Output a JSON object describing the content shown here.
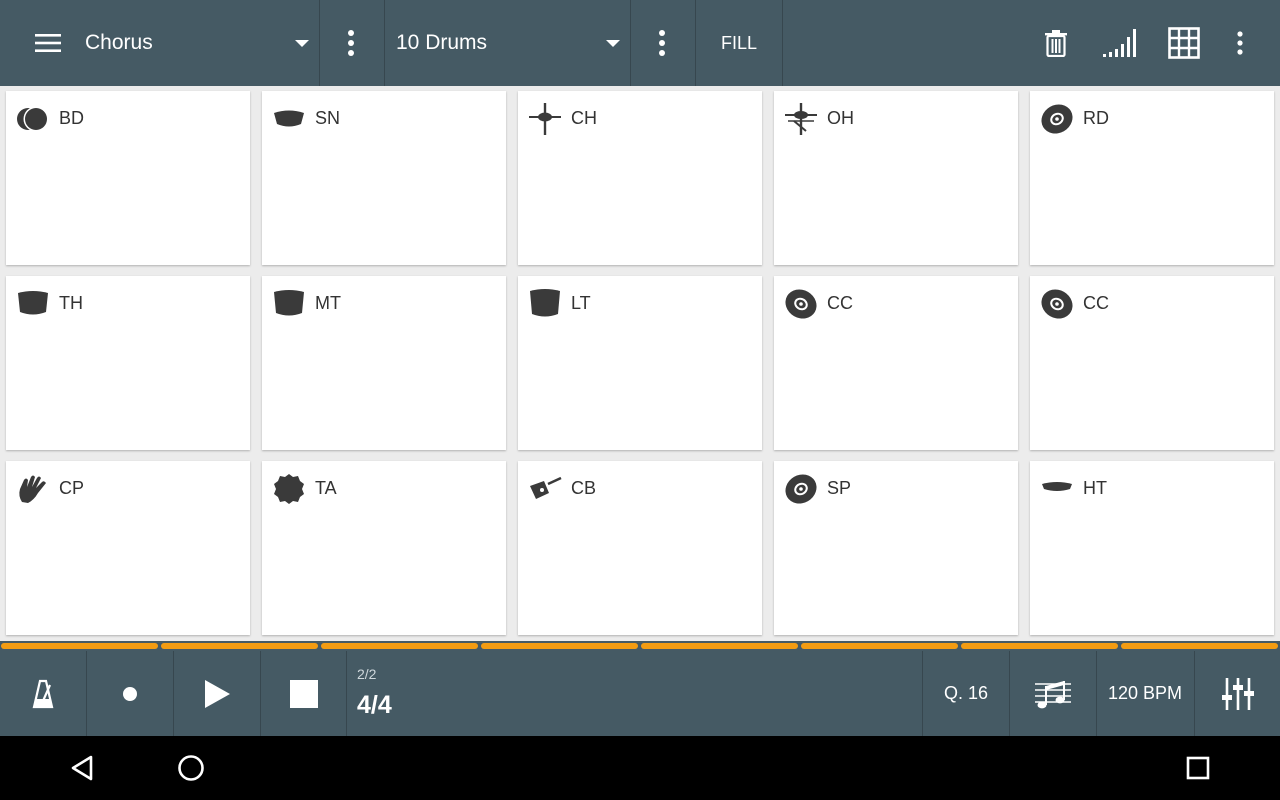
{
  "toolbar": {
    "menu_icon": "menu-icon",
    "pattern_select": "Chorus",
    "kit_select": "10 Drums",
    "fill_label": "FILL",
    "icons": [
      "trash-icon",
      "velocity-signal-icon",
      "grid-view-icon",
      "more-vert-icon"
    ]
  },
  "pads": [
    {
      "label": "BD",
      "icon": "bass-drum-icon"
    },
    {
      "label": "SN",
      "icon": "snare-drum-icon"
    },
    {
      "label": "CH",
      "icon": "closed-hihat-icon"
    },
    {
      "label": "OH",
      "icon": "open-hihat-icon"
    },
    {
      "label": "RD",
      "icon": "ride-cymbal-icon"
    },
    {
      "label": "TH",
      "icon": "high-tom-icon"
    },
    {
      "label": "MT",
      "icon": "mid-tom-icon"
    },
    {
      "label": "LT",
      "icon": "low-tom-icon"
    },
    {
      "label": "CC",
      "icon": "crash-cymbal-icon"
    },
    {
      "label": "CC",
      "icon": "crash-cymbal-icon"
    },
    {
      "label": "CP",
      "icon": "clap-hand-icon"
    },
    {
      "label": "TA",
      "icon": "tambourine-icon"
    },
    {
      "label": "CB",
      "icon": "cowbell-icon"
    },
    {
      "label": "SP",
      "icon": "splash-cymbal-icon"
    },
    {
      "label": "HT",
      "icon": "hihat-icon"
    }
  ],
  "progress": {
    "segments": 8,
    "active_segments": 8
  },
  "transport": {
    "icons": [
      "metronome-icon",
      "record-icon",
      "play-icon",
      "stop-icon"
    ],
    "bar_position": "2/2",
    "time_signature": "4/4",
    "quantize": "Q. 16",
    "score_icon": "music-notes-icon",
    "tempo": "120 BPM",
    "mixer_icon": "mixer-sliders-icon"
  },
  "system_nav": [
    "back-icon",
    "home-icon",
    "recents-icon"
  ],
  "colors": {
    "toolbar": "#455a64",
    "accent": "#f39c12",
    "icon": "#3a3a3a",
    "pad": "#ffffff",
    "navbar": "#000000"
  }
}
